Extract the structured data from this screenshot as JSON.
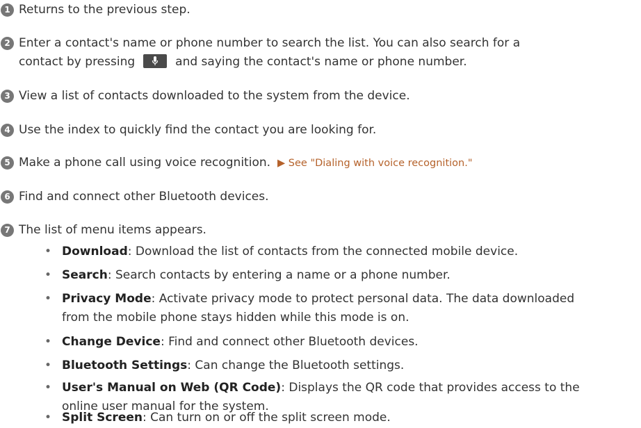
{
  "steps": [
    {
      "num": "1",
      "text": "Returns to the previous step."
    },
    {
      "num": "2",
      "line1": "Enter a contact's name or phone number to search the list. You can also search for a",
      "line2_before": "contact by pressing",
      "line2_after": "and saying the contact's name or phone number.",
      "icon": "microphone-icon"
    },
    {
      "num": "3",
      "text": "View a list of contacts downloaded to the system from the device."
    },
    {
      "num": "4",
      "text": "Use the index to quickly find the contact you are looking for."
    },
    {
      "num": "5",
      "text": "Make a phone call using voice recognition.",
      "link": "▶ See \"Dialing with voice recognition.\""
    },
    {
      "num": "6",
      "text": "Find and connect other Bluetooth devices."
    },
    {
      "num": "7",
      "text": "The list of menu items appears."
    }
  ],
  "menu_items": [
    {
      "term": "Download",
      "desc": ": Download the list of contacts from the connected mobile device."
    },
    {
      "term": "Search",
      "desc": ": Search contacts by entering a name or a phone number."
    },
    {
      "term": "Privacy Mode",
      "desc": ": Activate privacy mode to protect personal data. The data downloaded",
      "desc2": "from the mobile phone stays hidden while this mode is on."
    },
    {
      "term": "Change Device",
      "desc": ": Find and connect other Bluetooth devices."
    },
    {
      "term": "Bluetooth Settings",
      "desc": ": Can change the Bluetooth settings."
    },
    {
      "term": "User's Manual on Web (QR Code)",
      "desc": ": Displays the QR code that provides access to the",
      "desc2": "online user manual for the system."
    },
    {
      "term": "Split Screen",
      "desc": ": Can turn on or off the split screen mode."
    }
  ],
  "colors": {
    "text": "#333333",
    "number_badge": "#777777",
    "link": "#b5622b",
    "button": "#4a4a4a"
  }
}
